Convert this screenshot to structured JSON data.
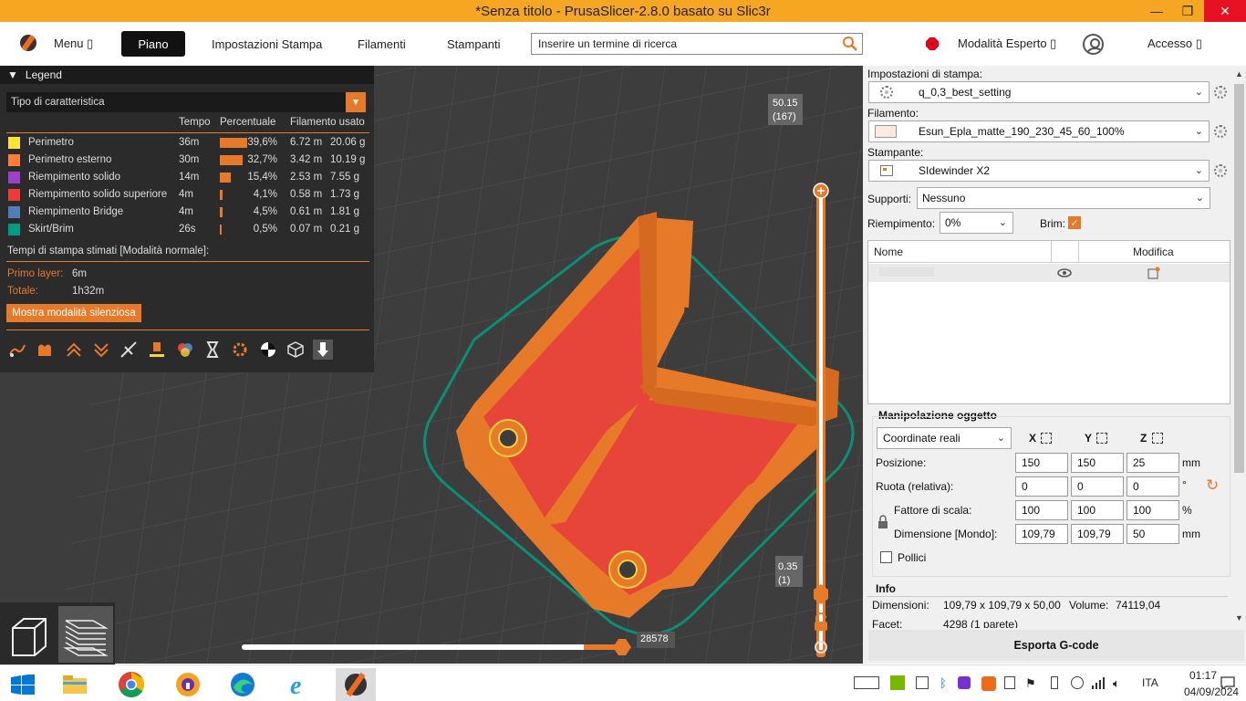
{
  "window": {
    "title": "*Senza titolo - PrusaSlicer-2.8.0 basato su Slic3r",
    "min": "—",
    "max": "❐",
    "close": "✕"
  },
  "topbar": {
    "menu": "Menu ▯",
    "tabs": [
      "Piano",
      "Impostazioni Stampa",
      "Filamenti",
      "Stampanti"
    ],
    "search_placeholder": "Inserire un termine di ricerca",
    "mode": "Modalità Esperto ▯",
    "login": "Accesso ▯"
  },
  "legend": {
    "title": "Legend",
    "type": "Tipo di caratteristica",
    "col_time": "Tempo",
    "col_pct": "Percentuale",
    "col_fil": "Filamento usato",
    "rows": [
      {
        "label": "Perimetro",
        "time": "36m",
        "pct": "39,6%",
        "pct_value": 39.6,
        "m": "6.72 m",
        "g": "20.06 g",
        "color": "#ffe433"
      },
      {
        "label": "Perimetro esterno",
        "time": "30m",
        "pct": "32,7%",
        "pct_value": 32.7,
        "m": "3.42 m",
        "g": "10.19 g",
        "color": "#ff7d38"
      },
      {
        "label": "Riempimento solido",
        "time": "14m",
        "pct": "15,4%",
        "pct_value": 15.4,
        "m": "2.53 m",
        "g": "7.55 g",
        "color": "#9b41c8"
      },
      {
        "label": "Riempimento solido superiore",
        "time": "4m",
        "pct": "4,1%",
        "pct_value": 4.1,
        "m": "0.58 m",
        "g": "1.73 g",
        "color": "#f03a3a"
      },
      {
        "label": "Riempimento Bridge",
        "time": "4m",
        "pct": "4,5%",
        "pct_value": 4.5,
        "m": "0.61 m",
        "g": "1.81 g",
        "color": "#4d80b8"
      },
      {
        "label": "Skirt/Brim",
        "time": "26s",
        "pct": "0,5%",
        "pct_value": 0.5,
        "m": "0.07 m",
        "g": "0.21 g",
        "color": "#009b86"
      }
    ],
    "estimates_title": "Tempi di stampa stimati [Modalità normale]:",
    "first_layer_label": "Primo layer:",
    "first_layer_value": "6m",
    "total_label": "Totale:",
    "total_value": "1h32m",
    "silent_button": "Mostra modalità silenziosa"
  },
  "sliders": {
    "top_value": "50.15",
    "top_layer": "(167)",
    "bottom_value": "0.35",
    "bottom_layer": "(1)",
    "horizontal_value": "28578"
  },
  "panel": {
    "print_settings_label": "Impostazioni di stampa:",
    "print_settings_value": "q_0,3_best_setting",
    "filament_label": "Filamento:",
    "filament_value": "Esun_Epla_matte_190_230_45_60_100%",
    "printer_label": "Stampante:",
    "printer_value": "SIdewinder X2",
    "supports_label": "Supporti:",
    "supports_value": "Nessuno",
    "infill_label": "Riempimento:",
    "infill_value": "0%",
    "brim_label": "Brim:",
    "list_name": "Nome",
    "list_edit": "Modifica",
    "manip_title": "Manipolazione oggetto",
    "coords": "Coordinate reali",
    "axis_x": "X",
    "axis_y": "Y",
    "axis_z": "Z",
    "pos_label": "Posizione:",
    "pos": [
      "150",
      "150",
      "25"
    ],
    "pos_unit": "mm",
    "rot_label": "Ruota (relativa):",
    "rot": [
      "0",
      "0",
      "0"
    ],
    "rot_unit": "°",
    "scale_label": "Fattore di scala:",
    "scale": [
      "100",
      "100",
      "100"
    ],
    "scale_unit": "%",
    "dim_label": "Dimensione [Mondo]:",
    "dim": [
      "109,79",
      "109,79",
      "50"
    ],
    "dim_unit": "mm",
    "inches": "Pollici",
    "info_title": "Info",
    "info_dim_label": "Dimensioni:",
    "info_dim": "109,79 x 109,79 x 50,00",
    "info_vol_label": "Volume:",
    "info_vol": "74119,04",
    "info_facets_label": "Facet:",
    "info_facets": "4298 (1 parete)",
    "export": "Esporta G-code"
  },
  "taskbar": {
    "lang": "ITA",
    "time": "01:17",
    "date": "04/09/2024"
  }
}
